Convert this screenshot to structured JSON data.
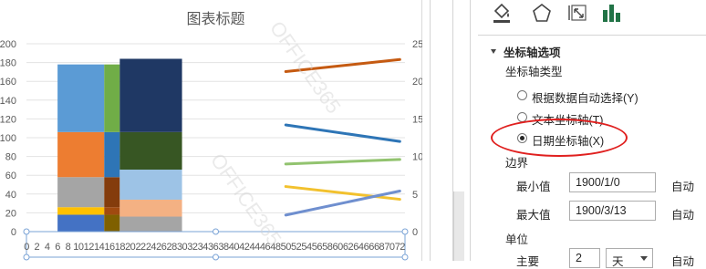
{
  "chart": {
    "title": "图表标题",
    "watermarks": [
      "OFFICE365",
      "OFFICE365"
    ]
  },
  "chart_data": {
    "type": "bar",
    "title": "图表标题",
    "primary_y": {
      "ticks": [
        0,
        20,
        40,
        60,
        80,
        100,
        120,
        140,
        160,
        180,
        200
      ],
      "range": [
        0,
        200
      ]
    },
    "secondary_y": {
      "ticks": [
        0,
        5,
        10,
        15,
        20,
        25
      ],
      "range": [
        0,
        25
      ]
    },
    "x_ticks": [
      "0",
      "2",
      "4",
      "6",
      "8",
      "10",
      "12",
      "14",
      "16",
      "18",
      "20",
      "22",
      "24",
      "26",
      "28",
      "30",
      "32",
      "34",
      "36",
      "38",
      "40",
      "42",
      "44",
      "46",
      "48",
      "50",
      "52",
      "54",
      "56",
      "58",
      "60",
      "62",
      "64",
      "66",
      "68",
      "70",
      "72"
    ],
    "x_range": [
      0,
      73
    ],
    "stacked_bars": [
      {
        "x_start": 6,
        "x_end": 15,
        "segments": [
          {
            "value": 18,
            "color": "#4472c4"
          },
          {
            "value": 8,
            "color": "#ffc000"
          },
          {
            "value": 32,
            "color": "#a5a5a5"
          },
          {
            "value": 48,
            "color": "#ed7d31"
          },
          {
            "value": 72,
            "color": "#5b9bd5"
          }
        ]
      },
      {
        "x_start": 15,
        "x_end": 18,
        "segments": [
          {
            "value": 18,
            "color": "#7f6000"
          },
          {
            "value": 8,
            "color": "#a04a10"
          },
          {
            "value": 32,
            "color": "#843c0c"
          },
          {
            "value": 48,
            "color": "#2e75b6"
          },
          {
            "value": 72,
            "color": "#70ad47"
          }
        ]
      },
      {
        "x_start": 18,
        "x_end": 30,
        "segments": [
          {
            "value": 16,
            "color": "#a5a5a5"
          },
          {
            "value": 18,
            "color": "#f4b183"
          },
          {
            "value": 32,
            "color": "#9dc3e6"
          },
          {
            "value": 40,
            "color": "#375623"
          },
          {
            "value": 78,
            "color": "#1f3864"
          }
        ]
      }
    ],
    "lines_secondary_axis": [
      {
        "x": [
          50,
          72
        ],
        "y": [
          21.3,
          22.9
        ],
        "color": "#c55a11"
      },
      {
        "x": [
          50,
          72
        ],
        "y": [
          14.2,
          12.0
        ],
        "color": "#2e75b6"
      },
      {
        "x": [
          50,
          72
        ],
        "y": [
          9.0,
          9.6
        ],
        "color": "#92c36f"
      },
      {
        "x": [
          50,
          72
        ],
        "y": [
          6.0,
          4.3
        ],
        "color": "#f2c12e"
      },
      {
        "x": [
          50,
          72
        ],
        "y": [
          2.2,
          5.4
        ],
        "color": "#6f8fcf"
      }
    ]
  },
  "pane": {
    "tabs": [
      {
        "name": "fill-line-tab",
        "icon": "paint-bucket-icon"
      },
      {
        "name": "effects-tab",
        "icon": "pentagon-icon"
      },
      {
        "name": "size-properties-tab",
        "icon": "size-properties-icon"
      },
      {
        "name": "axis-options-tab",
        "icon": "bar-chart-icon",
        "selected": true
      }
    ],
    "section_title": "坐标轴选项",
    "axis_type_label": "坐标轴类型",
    "axis_type_options": [
      {
        "label": "根据数据自动选择(Y)",
        "selected": false
      },
      {
        "label": "文本坐标轴(T)",
        "selected": false
      },
      {
        "label": "日期坐标轴(X)",
        "selected": true
      }
    ],
    "bounds_label": "边界",
    "min_label": "最小值",
    "min_value": "1900/1/0",
    "min_auto": "自动",
    "max_label": "最大值",
    "max_value": "1900/3/13",
    "max_auto": "自动",
    "units_label": "单位",
    "major_label": "主要",
    "major_value": "2",
    "major_unit": "天",
    "major_auto": "自动"
  }
}
